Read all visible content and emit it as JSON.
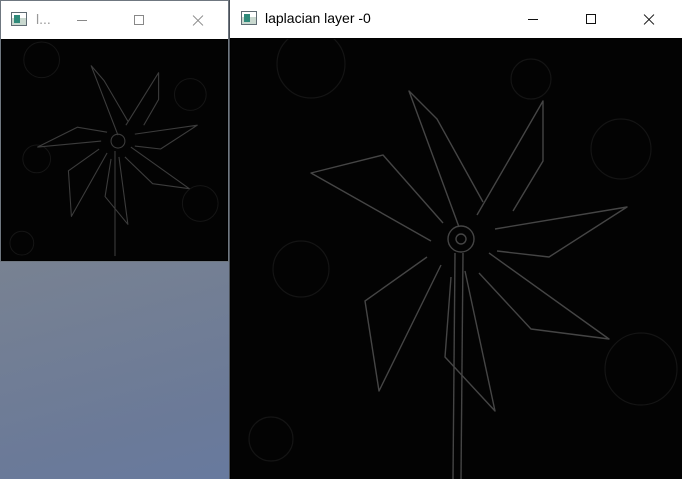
{
  "small_window": {
    "title": "l...",
    "icon": "opencv-window-icon"
  },
  "main_window": {
    "title": "laplacian layer -0",
    "icon": "opencv-window-icon"
  },
  "image": {
    "subject": "pinwheel-edges",
    "background_color": "#030303",
    "edge_color": "#4a4a4a"
  }
}
